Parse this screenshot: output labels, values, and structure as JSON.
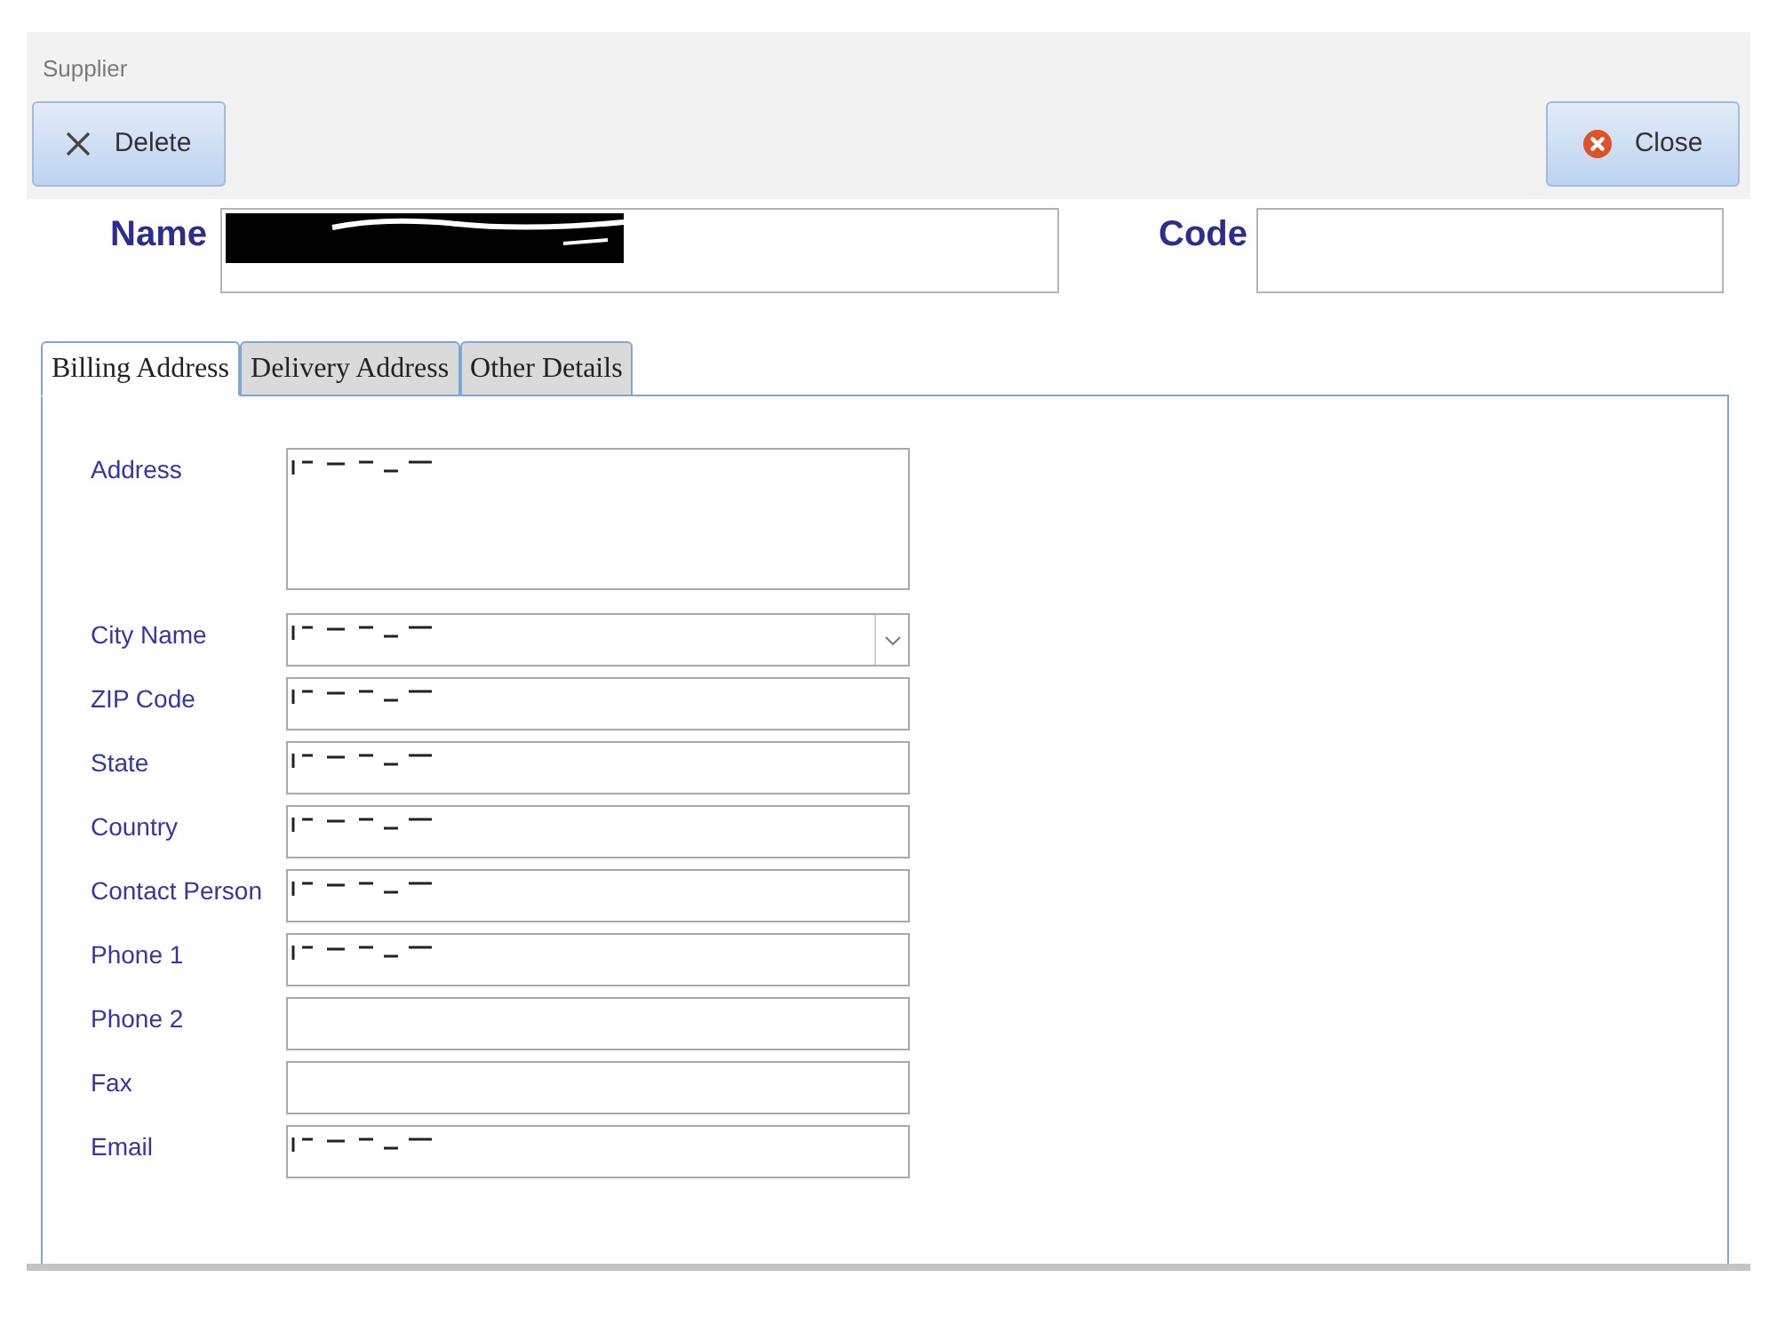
{
  "window": {
    "title": "Supplier"
  },
  "toolbar": {
    "buttons": [
      {
        "label": "Delete",
        "kind": "delete"
      },
      {
        "label": "Close",
        "kind": "close"
      }
    ]
  },
  "header_fields": [
    {
      "label": "Name",
      "redacted": true
    },
    {
      "label": "Code",
      "redacted": false
    }
  ],
  "tabs": [
    {
      "label": "Billing Address",
      "selected": true
    },
    {
      "label": "Delivery Address",
      "selected": false
    },
    {
      "label": "Other Details",
      "selected": false
    }
  ],
  "form": {
    "fields": [
      {
        "label": "Address",
        "kind": "multiline",
        "redacted": true
      },
      {
        "label": "City Name",
        "kind": "dropdown",
        "redacted": true
      },
      {
        "label": "ZIP Code",
        "kind": "text",
        "redacted": true
      },
      {
        "label": "State",
        "kind": "text",
        "redacted": true
      },
      {
        "label": "Country",
        "kind": "text",
        "redacted": true
      },
      {
        "label": "Contact Person",
        "kind": "text",
        "redacted": true
      },
      {
        "label": "Phone 1",
        "kind": "text",
        "redacted": true
      },
      {
        "label": "Phone 2",
        "kind": "text",
        "redacted": false
      },
      {
        "label": "Fax",
        "kind": "text",
        "redacted": false
      },
      {
        "label": "Email",
        "kind": "text",
        "redacted": true
      }
    ]
  }
}
